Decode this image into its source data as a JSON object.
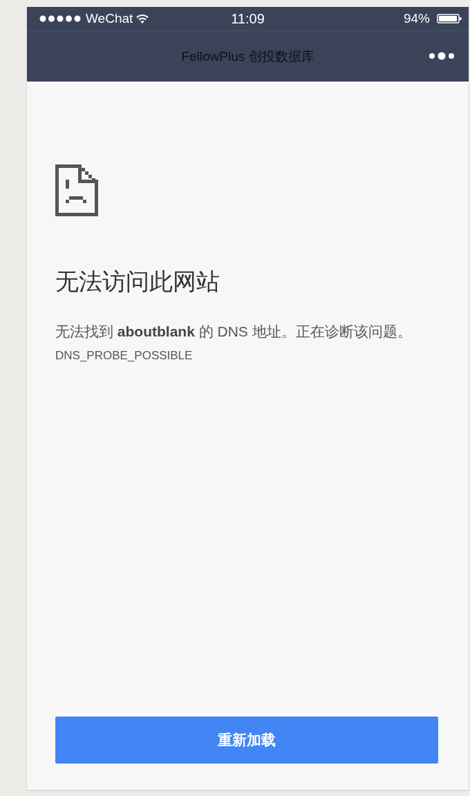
{
  "status_bar": {
    "carrier": "WeChat",
    "time": "11:09",
    "battery": "94%"
  },
  "nav_bar": {
    "title": "FellowPlus 创投数据库"
  },
  "error": {
    "title": "无法访问此网站",
    "message": "无法找到 **aboutblank** 的 DNS 地址。正在诊断该问题。",
    "code": "DNS_PROBE_POSSIBLE"
  },
  "button": {
    "label": "重新加载"
  }
}
